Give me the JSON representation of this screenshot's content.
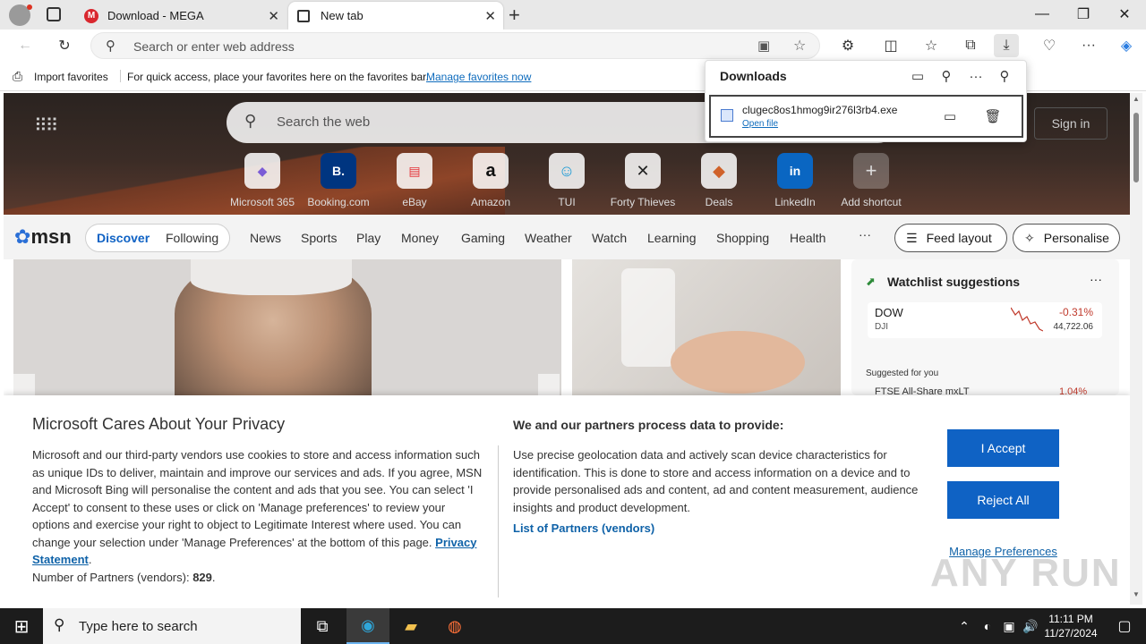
{
  "browser": {
    "tabs": [
      {
        "title": "Download - MEGA",
        "favicon": "mega-icon"
      },
      {
        "title": "New tab",
        "favicon": "newtab-icon"
      }
    ],
    "address_placeholder": "Search or enter web address"
  },
  "favorites_bar": {
    "import_label": "Import favorites",
    "hint": "For quick access, place your favorites here on the favorites bar.",
    "manage_link": "Manage favorites now"
  },
  "downloads": {
    "title": "Downloads",
    "file_name": "clugec8os1hmog9ir276l3rb4.exe",
    "open_file": "Open file"
  },
  "newtab": {
    "search_placeholder": "Search the web",
    "sign_in": "Sign in",
    "shortcuts": [
      {
        "label": "Microsoft 365",
        "glyph": "◆",
        "color": "#7b5cd6"
      },
      {
        "label": "Booking.com",
        "glyph": "B.",
        "color": "#003580"
      },
      {
        "label": "eBay",
        "glyph": "🛍",
        "color": "#e53238"
      },
      {
        "label": "Amazon",
        "glyph": "a",
        "color": "#111111"
      },
      {
        "label": "TUI",
        "glyph": "☺",
        "color": "#1c9ad6"
      },
      {
        "label": "Forty Thieves",
        "glyph": "✕",
        "color": "#222222"
      },
      {
        "label": "Deals",
        "glyph": "◆",
        "color": "#d0622a"
      },
      {
        "label": "LinkedIn",
        "glyph": "in",
        "color": "#0a66c2"
      },
      {
        "label": "Add shortcut",
        "glyph": "+",
        "color": "#666666"
      }
    ]
  },
  "msn": {
    "logo": "msn",
    "tabs": [
      "Discover",
      "Following"
    ],
    "nav": [
      "News",
      "Sports",
      "Play",
      "Money",
      "Gaming",
      "Weather",
      "Watch",
      "Learning",
      "Shopping",
      "Health"
    ],
    "more": "···",
    "feed_layout": "Feed layout",
    "personalise": "Personalise",
    "watchlist": {
      "title": "Watchlist suggestions",
      "symbol": "DOW",
      "sub": "DJI",
      "change": "-0.31%",
      "price": "44,722.06",
      "suggested": "Suggested for you",
      "next_symbol": "FTSE All-Share mxLT",
      "next_change": "1.04%"
    }
  },
  "consent": {
    "title": "Microsoft Cares About Your Privacy",
    "body": "Microsoft and our third-party vendors use cookies to store and access information such as unique IDs to deliver, maintain and improve our services and ads. If you agree, MSN and Microsoft Bing will personalise the content and ads that you see. You can select 'I Accept' to consent to these uses or click on 'Manage preferences' to review your options and exercise your right to object to Legitimate Interest where used.  You can change your selection under 'Manage Preferences' at the bottom of this page.",
    "privacy_link": "Privacy Statement",
    "partners_prefix": "Number of Partners (vendors):",
    "partners_count": "829",
    "right_title": "We and our partners process data to provide:",
    "right_body": "Use precise geolocation data and actively scan device characteristics for identification. This is done to store and access information on a device and to provide personalised ads and content, ad and content measurement, audience insights and product development.",
    "partners_link": "List of Partners (vendors)",
    "accept": "I Accept",
    "reject": "Reject All",
    "manage": "Manage Preferences"
  },
  "taskbar": {
    "search_placeholder": "Type here to search",
    "time": "11:11 PM",
    "date": "11/27/2024"
  },
  "watermark": "ANY RUN"
}
